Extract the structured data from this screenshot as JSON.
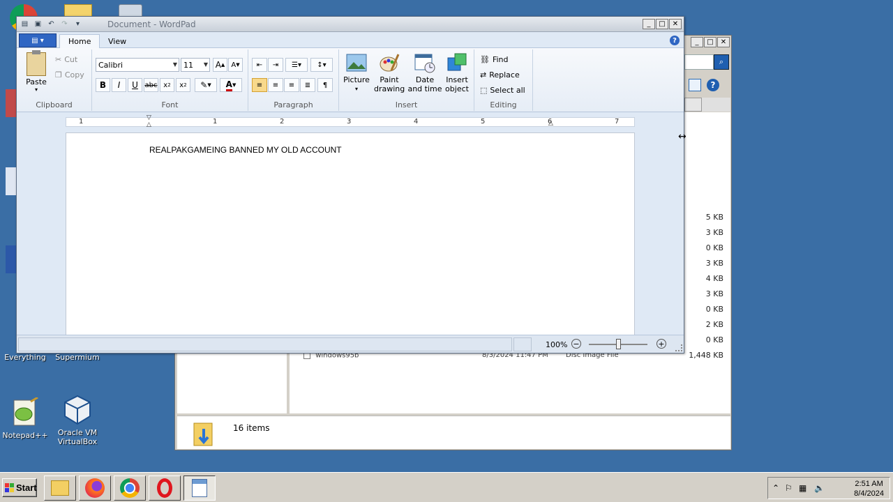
{
  "desktop": {
    "icons": [
      {
        "name": "Everything"
      },
      {
        "name": "Supermium"
      },
      {
        "name": "Notepad++"
      },
      {
        "name": "Oracle VM VirtualBox"
      }
    ]
  },
  "explorer": {
    "sizes": [
      "5 KB",
      "3 KB",
      "0 KB",
      "3 KB",
      "4 KB",
      "3 KB",
      "0 KB",
      "2 KB",
      "0 KB",
      "1,448 KB"
    ],
    "partial_file": "windows95b",
    "partial_date": "8/3/2024 11:47 PM",
    "partial_type": "Disc Image File",
    "status_count": "16 items"
  },
  "wordpad": {
    "title": "Document - WordPad",
    "tabs": {
      "home": "Home",
      "view": "View"
    },
    "clipboard": {
      "paste": "Paste",
      "cut": "Cut",
      "copy": "Copy",
      "label": "Clipboard"
    },
    "font": {
      "family": "Calibri",
      "size": "11",
      "label": "Font"
    },
    "paragraph": {
      "label": "Paragraph"
    },
    "insert": {
      "picture": "Picture",
      "paint": "Paint drawing",
      "datetime": "Date and time",
      "object": "Insert object",
      "label": "Insert"
    },
    "editing": {
      "find": "Find",
      "replace": "Replace",
      "select_all": "Select all",
      "label": "Editing"
    },
    "ruler_numbers": [
      "1",
      "1",
      "2",
      "3",
      "4",
      "5",
      "6",
      "7"
    ],
    "document_text": "REALPAKGAMEING BANNED MY OLD ACCOUNT",
    "zoom": "100%"
  },
  "taskbar": {
    "start": "Start",
    "clock_time": "2:51 AM",
    "clock_date": "8/4/2024"
  },
  "colors": {
    "desktop": "#3a6ea5",
    "ribbon_accent": "#2f66c3",
    "active_align": "#f8d98b"
  }
}
